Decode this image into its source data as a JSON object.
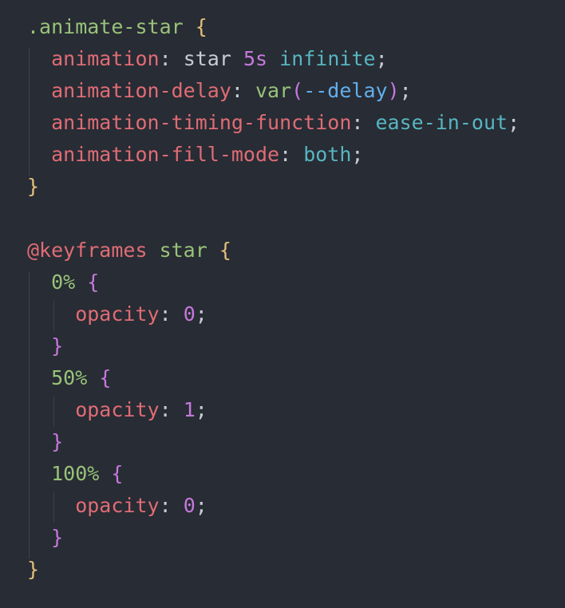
{
  "code_lines": [
    [
      {
        "t": ".animate-star",
        "c": "c-sel"
      },
      {
        "t": " ",
        "c": "c-plain"
      },
      {
        "t": "{",
        "c": "c-brace"
      }
    ],
    [
      {
        "t": "  animation",
        "c": "c-prop"
      },
      {
        "t": ": ",
        "c": "c-punc"
      },
      {
        "t": "star",
        "c": "c-plain"
      },
      {
        "t": " ",
        "c": "c-plain"
      },
      {
        "t": "5s",
        "c": "c-num"
      },
      {
        "t": " ",
        "c": "c-plain"
      },
      {
        "t": "infinite",
        "c": "c-kw"
      },
      {
        "t": ";",
        "c": "c-punc"
      }
    ],
    [
      {
        "t": "  animation-delay",
        "c": "c-prop"
      },
      {
        "t": ": ",
        "c": "c-punc"
      },
      {
        "t": "var",
        "c": "c-func"
      },
      {
        "t": "(",
        "c": "c-brace2"
      },
      {
        "t": "--delay",
        "c": "c-var"
      },
      {
        "t": ")",
        "c": "c-brace2"
      },
      {
        "t": ";",
        "c": "c-punc"
      }
    ],
    [
      {
        "t": "  animation-timing-function",
        "c": "c-prop"
      },
      {
        "t": ": ",
        "c": "c-punc"
      },
      {
        "t": "ease-in-out",
        "c": "c-kw"
      },
      {
        "t": ";",
        "c": "c-punc"
      }
    ],
    [
      {
        "t": "  animation-fill-mode",
        "c": "c-prop"
      },
      {
        "t": ": ",
        "c": "c-punc"
      },
      {
        "t": "both",
        "c": "c-kw"
      },
      {
        "t": ";",
        "c": "c-punc"
      }
    ],
    [
      {
        "t": "}",
        "c": "c-brace"
      }
    ],
    [],
    [
      {
        "t": "@keyframes",
        "c": "c-at"
      },
      {
        "t": " ",
        "c": "c-plain"
      },
      {
        "t": "star",
        "c": "c-sel"
      },
      {
        "t": " ",
        "c": "c-plain"
      },
      {
        "t": "{",
        "c": "c-brace"
      }
    ],
    [
      {
        "t": "  0%",
        "c": "c-sel"
      },
      {
        "t": " ",
        "c": "c-plain"
      },
      {
        "t": "{",
        "c": "c-brace2"
      }
    ],
    [
      {
        "t": "    opacity",
        "c": "c-prop"
      },
      {
        "t": ": ",
        "c": "c-punc"
      },
      {
        "t": "0",
        "c": "c-num"
      },
      {
        "t": ";",
        "c": "c-punc"
      }
    ],
    [
      {
        "t": "  }",
        "c": "c-brace2"
      }
    ],
    [
      {
        "t": "  50%",
        "c": "c-sel"
      },
      {
        "t": " ",
        "c": "c-plain"
      },
      {
        "t": "{",
        "c": "c-brace2"
      }
    ],
    [
      {
        "t": "    opacity",
        "c": "c-prop"
      },
      {
        "t": ": ",
        "c": "c-punc"
      },
      {
        "t": "1",
        "c": "c-num"
      },
      {
        "t": ";",
        "c": "c-punc"
      }
    ],
    [
      {
        "t": "  }",
        "c": "c-brace2"
      }
    ],
    [
      {
        "t": "  100%",
        "c": "c-sel"
      },
      {
        "t": " ",
        "c": "c-plain"
      },
      {
        "t": "{",
        "c": "c-brace2"
      }
    ],
    [
      {
        "t": "    opacity",
        "c": "c-prop"
      },
      {
        "t": ": ",
        "c": "c-punc"
      },
      {
        "t": "0",
        "c": "c-num"
      },
      {
        "t": ";",
        "c": "c-punc"
      }
    ],
    [
      {
        "t": "  }",
        "c": "c-brace2"
      }
    ],
    [
      {
        "t": "}",
        "c": "c-brace"
      }
    ]
  ],
  "theme": {
    "background": "#282c34",
    "selector": "#98c379",
    "brace_outer": "#e5c07b",
    "brace_inner": "#c678dd",
    "property": "#e06c75",
    "number": "#c678dd",
    "keyword_value": "#56b6c2"
  }
}
